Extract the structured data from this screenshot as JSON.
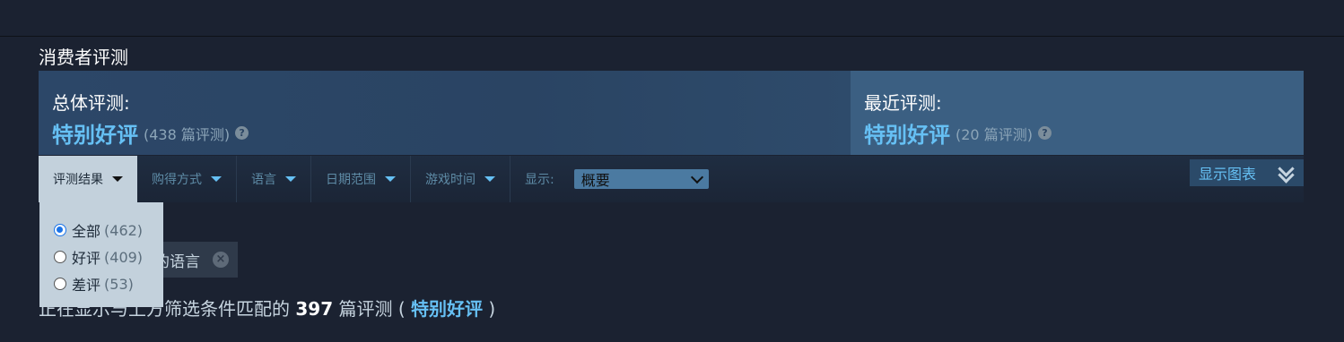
{
  "section": {
    "title": "消费者评测"
  },
  "overall": {
    "label": "总体评测:",
    "rating": "特别好评",
    "count": "(438 篇评测)",
    "help": "?"
  },
  "recent": {
    "label": "最近评测:",
    "rating": "特别好评",
    "count": "(20 篇评测)",
    "help": "?"
  },
  "filters": [
    {
      "label": "评测结果"
    },
    {
      "label": "购得方式"
    },
    {
      "label": "语言"
    },
    {
      "label": "日期范围"
    },
    {
      "label": "游戏时间"
    }
  ],
  "display": {
    "label": "显示:",
    "selected": "概要"
  },
  "show_graph": {
    "label": "显示图表"
  },
  "review_type_dropdown": {
    "options": [
      {
        "label": "全部",
        "count": "(462)",
        "checked": true
      },
      {
        "label": "好评",
        "count": "(409)",
        "checked": false
      },
      {
        "label": "差评",
        "count": "(53)",
        "checked": false
      }
    ]
  },
  "active_filter": {
    "visible_text": "的语言",
    "remove": "×"
  },
  "result": {
    "prefix": "正在显示与上方筛选条件匹配的",
    "count": "397",
    "unit": "篇评测 (",
    "rating": "特别好评",
    "suffix": ")"
  },
  "colors": {
    "accent": "#66c0f4",
    "background": "#1b2231",
    "dropdown_bg": "#c3d1dc"
  }
}
